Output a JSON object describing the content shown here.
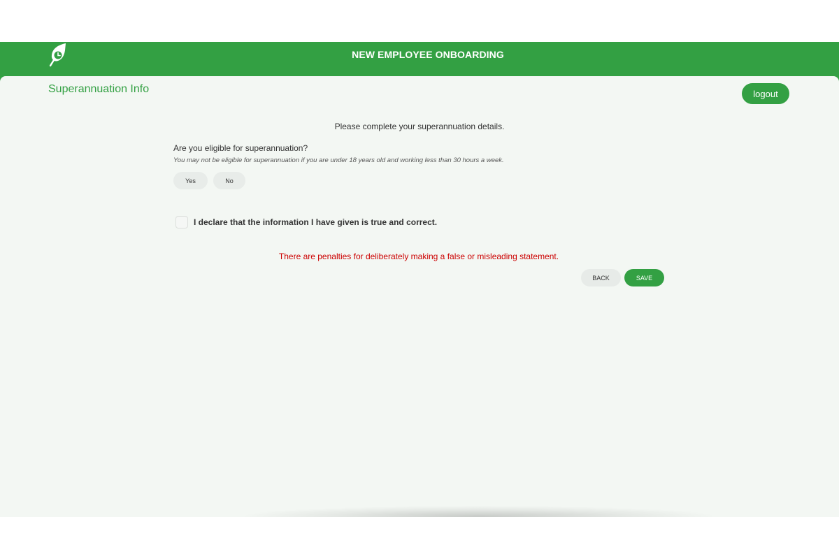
{
  "header": {
    "title": "NEW EMPLOYEE ONBOARDING",
    "logo_icon": "leaf-clock-icon",
    "color": "#33a043"
  },
  "page": {
    "title": "Superannuation Info",
    "logout_label": "logout",
    "intro": "Please complete your superannuation details."
  },
  "eligibility": {
    "question": "Are you eligible for superannuation?",
    "hint": "You may not be eligible for superannuation if you are under 18 years old and working less than 30 hours a week.",
    "yes_label": "Yes",
    "no_label": "No"
  },
  "declaration": {
    "label": "I declare that the information I have given is true and correct.",
    "checked": false
  },
  "warning": {
    "text": "There are penalties for deliberately making a false or misleading statement.",
    "color": "#cc0000"
  },
  "actions": {
    "back_label": "BACK",
    "save_label": "SAVE"
  }
}
